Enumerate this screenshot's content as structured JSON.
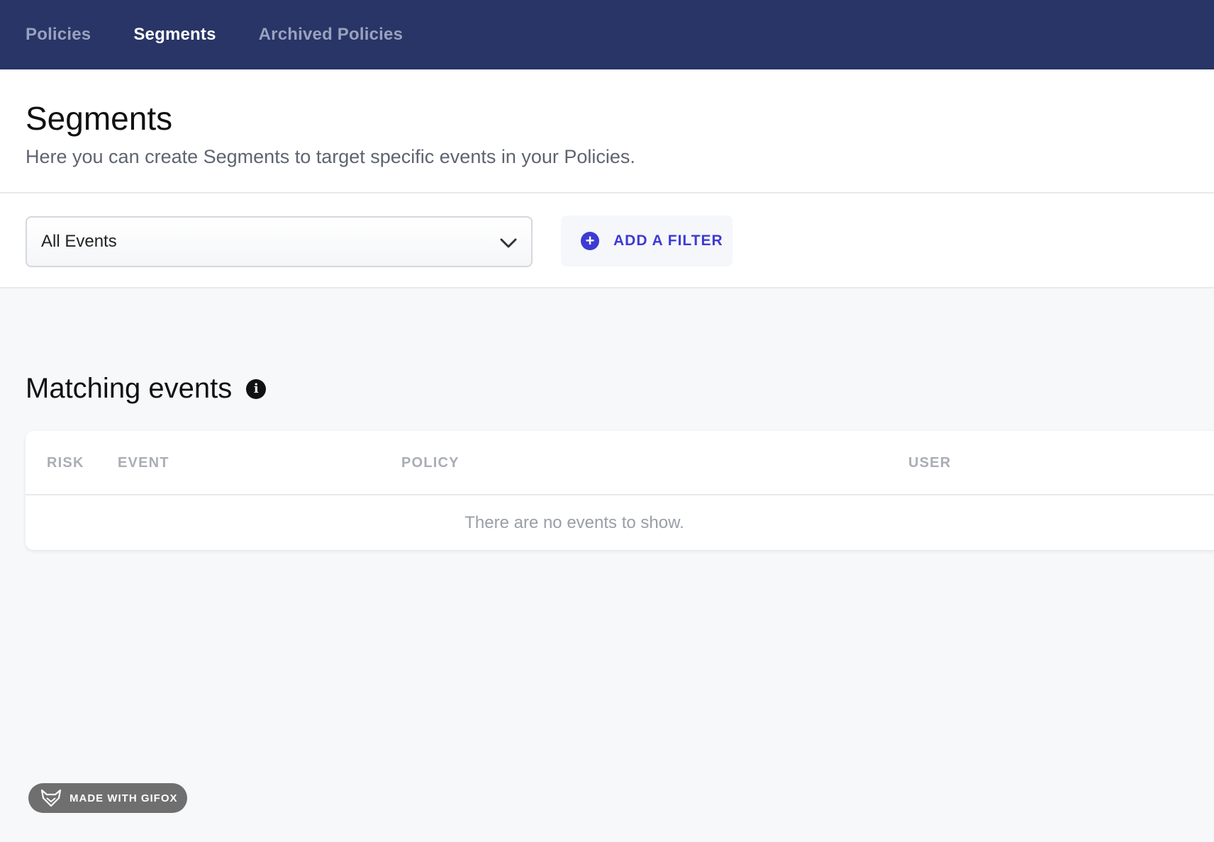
{
  "nav": {
    "tabs": [
      {
        "label": "Policies",
        "active": false
      },
      {
        "label": "Segments",
        "active": true
      },
      {
        "label": "Archived Policies",
        "active": false
      }
    ]
  },
  "header": {
    "title": "Segments",
    "subtitle": "Here you can create Segments to target specific events in your Policies."
  },
  "filters": {
    "event_select": {
      "value": "All Events",
      "icon": "chevron-down-icon"
    },
    "add_filter": {
      "label": "ADD A FILTER",
      "icon": "plus-circle-icon"
    }
  },
  "matching": {
    "title": "Matching events",
    "info_icon": "info-icon",
    "table": {
      "columns": [
        "RISK",
        "EVENT",
        "POLICY",
        "USER"
      ],
      "rows": [],
      "empty_message": "There are no events to show."
    }
  },
  "badge": {
    "label": "MADE WITH GIFOX",
    "icon": "fox-icon"
  },
  "colors": {
    "nav_bg": "#283566",
    "accent": "#3d3bd3",
    "page_bg": "#f7f8fa"
  }
}
